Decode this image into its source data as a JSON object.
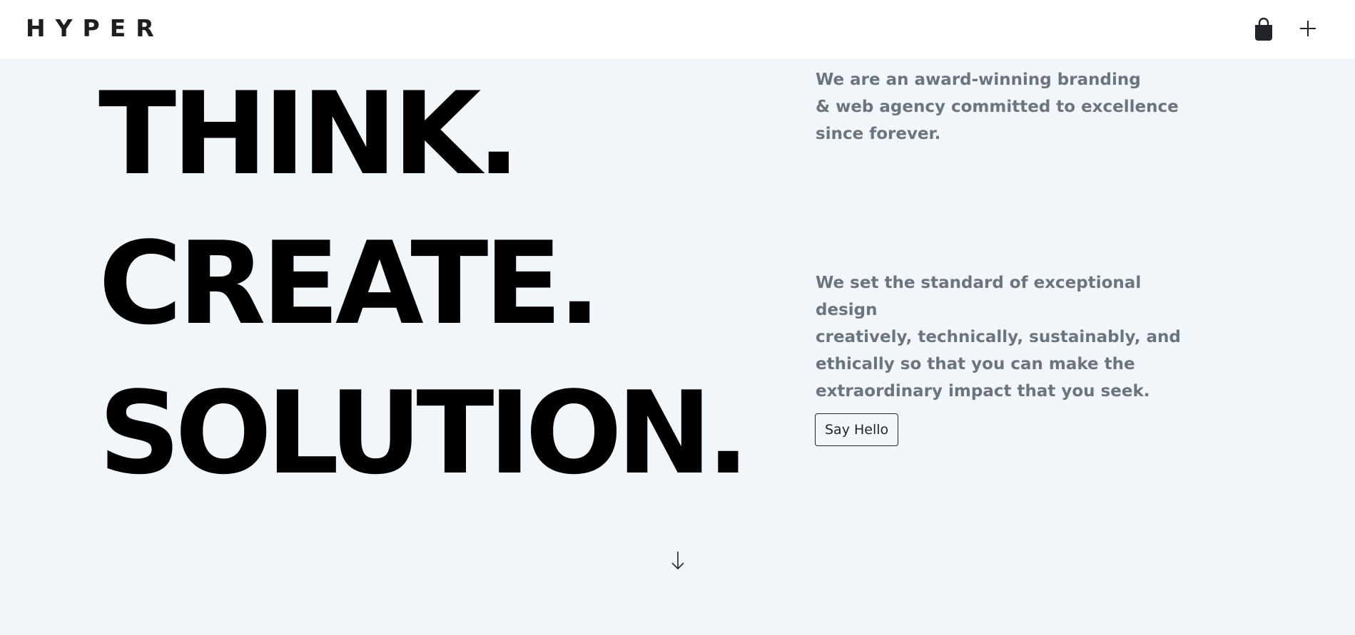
{
  "navbar": {
    "brand": "HYPER",
    "icons": {
      "bag": "shopping-bag-icon",
      "menu": "plus-icon"
    }
  },
  "hero": {
    "headline": [
      "THINK.",
      "CREATE.",
      "SOLUTION."
    ],
    "intro": "We are an award-winning branding\n& web agency committed to excellence\nsince forever.",
    "mission": "We set the standard of exceptional design\ncreatively, technically, sustainably, and\nethically so that you can make the\nextraordinary impact that you seek.",
    "cta_label": "Say Hello",
    "scroll_icon": "arrow-down-icon"
  },
  "colors": {
    "page_background": "#f0f6fa",
    "navbar_background": "#ffffff",
    "headline": "#000000",
    "body_text": "#6c757d",
    "button_border": "#212529"
  }
}
